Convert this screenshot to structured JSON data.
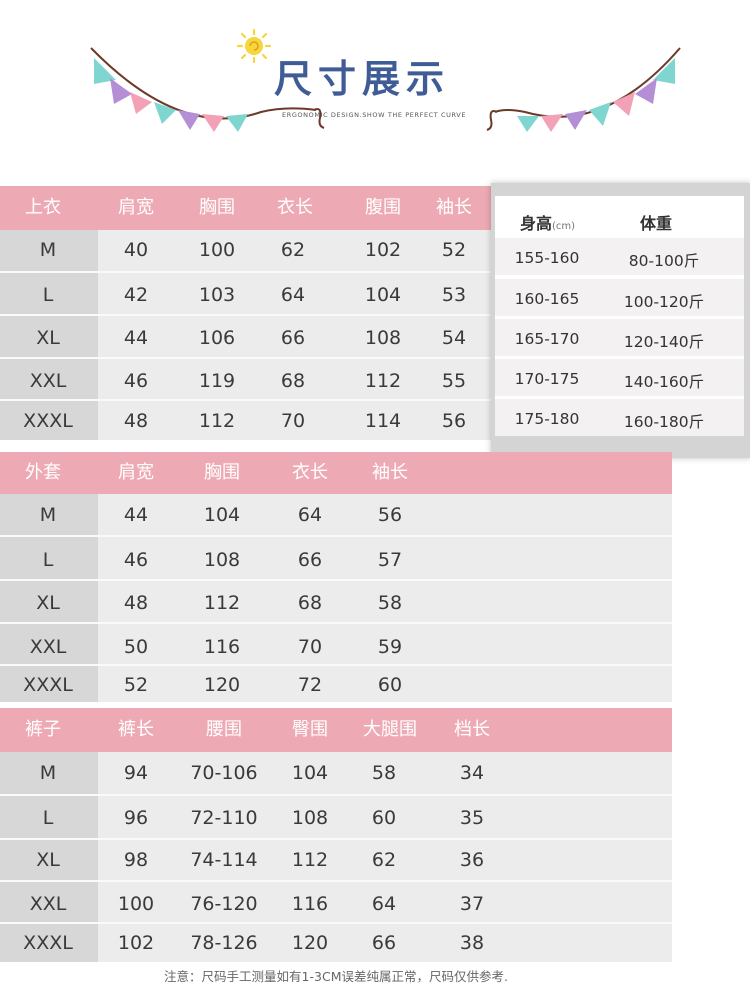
{
  "header": {
    "title": "尺寸展示",
    "subtitle": "ERGONOMIC DESIGN.SHOW THE PERFECT CURVE",
    "colors": {
      "title": "#3f5c96",
      "flag_pink": "#f2a1b6",
      "flag_purple": "#b48fd6",
      "flag_teal": "#7fd6d0",
      "sun": "#f5d63b"
    }
  },
  "tops": {
    "headers": [
      "上衣",
      "肩宽",
      "胸围",
      "衣长",
      "腹围",
      "袖长"
    ],
    "rows": [
      [
        "M",
        "40",
        "100",
        "62",
        "102",
        "52"
      ],
      [
        "L",
        "42",
        "103",
        "64",
        "104",
        "53"
      ],
      [
        "XL",
        "44",
        "106",
        "66",
        "108",
        "54"
      ],
      [
        "XXL",
        "46",
        "119",
        "68",
        "112",
        "55"
      ],
      [
        "XXXL",
        "48",
        "112",
        "70",
        "114",
        "56"
      ]
    ]
  },
  "coat": {
    "headers": [
      "外套",
      "肩宽",
      "胸围",
      "衣长",
      "袖长"
    ],
    "rows": [
      [
        "M",
        "44",
        "104",
        "64",
        "56"
      ],
      [
        "L",
        "46",
        "108",
        "66",
        "57"
      ],
      [
        "XL",
        "48",
        "112",
        "68",
        "58"
      ],
      [
        "XXL",
        "50",
        "116",
        "70",
        "59"
      ],
      [
        "XXXL",
        "52",
        "120",
        "72",
        "60"
      ]
    ]
  },
  "pants": {
    "headers": [
      "裤子",
      "裤长",
      "腰围",
      "臀围",
      "大腿围",
      "档长"
    ],
    "rows": [
      [
        "M",
        "94",
        "70-106",
        "104",
        "58",
        "34"
      ],
      [
        "L",
        "96",
        "72-110",
        "108",
        "60",
        "35"
      ],
      [
        "XL",
        "98",
        "74-114",
        "112",
        "62",
        "36"
      ],
      [
        "XXL",
        "100",
        "76-120",
        "116",
        "64",
        "37"
      ],
      [
        "XXXL",
        "102",
        "78-126",
        "120",
        "66",
        "38"
      ]
    ]
  },
  "height_weight": {
    "height_label": "身高",
    "height_unit": "(cm)",
    "weight_label": "体重",
    "rows": [
      [
        "155-160",
        "80-100斤"
      ],
      [
        "160-165",
        "100-120斤"
      ],
      [
        "165-170",
        "120-140斤"
      ],
      [
        "170-175",
        "140-160斤"
      ],
      [
        "175-180",
        "160-180斤"
      ]
    ]
  },
  "note": "注意：尺码手工测量如有1-3CM误差纯属正常，尺码仅供参考."
}
